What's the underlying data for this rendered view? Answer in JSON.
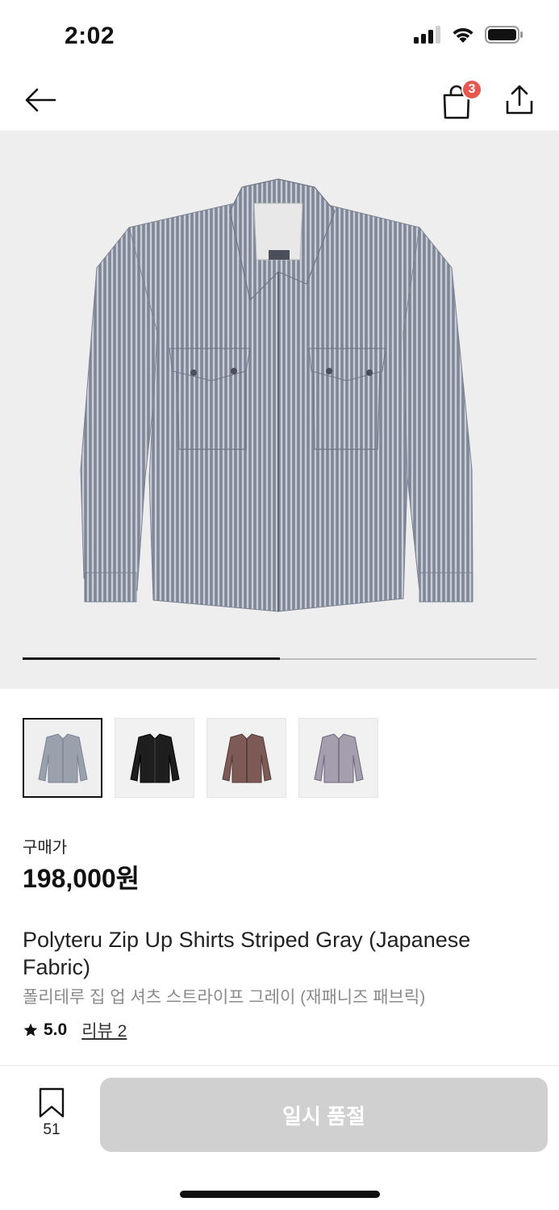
{
  "status_bar": {
    "time": "2:02",
    "icons": [
      "signal-icon",
      "wifi-icon",
      "battery-icon"
    ]
  },
  "nav": {
    "cart_count": "3",
    "icons": [
      "back-arrow-icon",
      "shopping-bag-icon",
      "share-icon"
    ]
  },
  "gallery": {
    "image_progress": 0.5,
    "thumbnails": [
      {
        "label": "gray-striped-shirt",
        "selected": true
      },
      {
        "label": "black-shirt",
        "selected": false
      },
      {
        "label": "brown-check-shirt",
        "selected": false
      },
      {
        "label": "gray-check-shirt",
        "selected": false
      }
    ]
  },
  "product": {
    "price_label": "구매가",
    "price": "198,000원",
    "title_en": "Polyteru Zip Up Shirts Striped Gray (Japanese Fabric)",
    "title_ko": "폴리테루 집 업 셔츠 스트라이프 그레이 (재패니즈 패브릭)",
    "rating": "5.0",
    "review_link": "리뷰 2"
  },
  "footer": {
    "bookmark_count": "51",
    "cta_label": "일시 품절"
  },
  "colors": {
    "badge": "#e8574f",
    "hero_bg": "#eeeeee",
    "disabled_button": "#d0d0d0"
  }
}
